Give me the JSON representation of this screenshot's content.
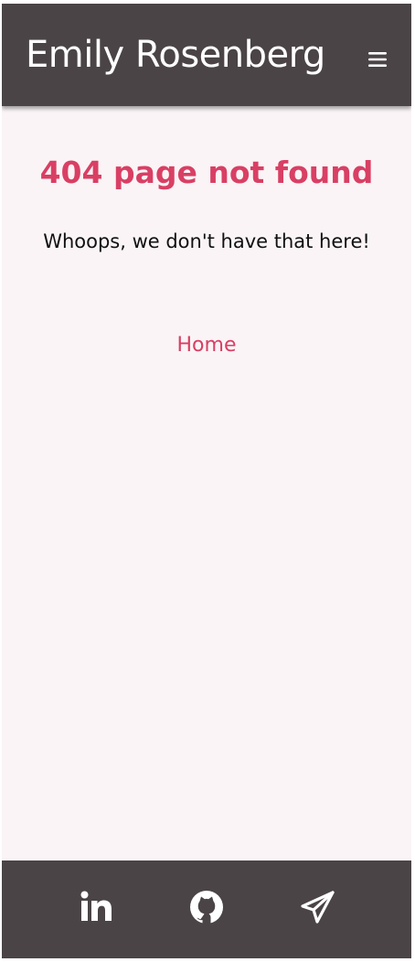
{
  "header": {
    "site_title": "Emily Rosenberg",
    "menu_icon": "hamburger-menu-icon"
  },
  "main": {
    "heading": "404 page not found",
    "message": "Whoops, we don't have that here!",
    "home_link": "Home"
  },
  "footer": {
    "links": [
      {
        "icon": "linkedin-icon"
      },
      {
        "icon": "github-icon"
      },
      {
        "icon": "paper-plane-icon"
      }
    ]
  },
  "colors": {
    "header_background": "#4a4446",
    "page_background": "#faf4f6",
    "accent": "#d93f64",
    "text": "#111111",
    "header_text": "#ffffff"
  }
}
